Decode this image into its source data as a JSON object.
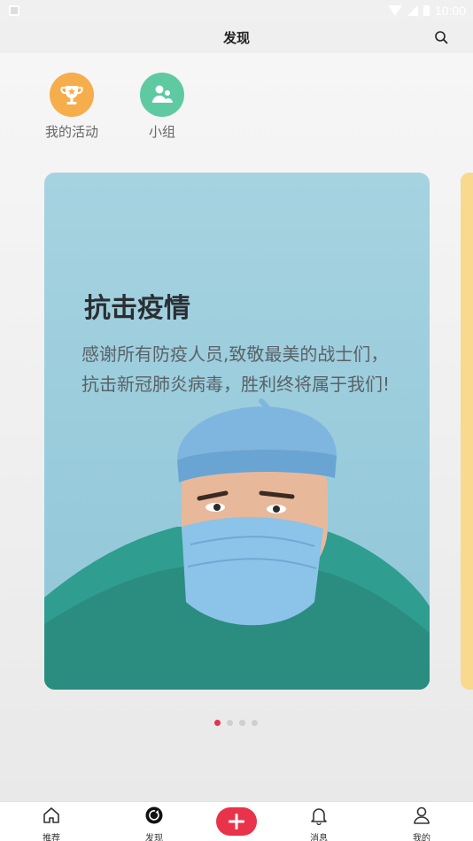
{
  "status_bar": {
    "time": "10:00"
  },
  "header": {
    "title": "发现",
    "search_icon": "search-icon"
  },
  "shortcuts": [
    {
      "label": "我的活动",
      "icon": "trophy-icon",
      "color": "#f6ad4c"
    },
    {
      "label": "小组",
      "icon": "group-icon",
      "color": "#5fcaa2"
    }
  ],
  "carousel": {
    "card": {
      "title": "抗击疫情",
      "description": "感谢所有防疫人员,致敬最美的战士们，抗击新冠肺炎病毒，胜利终将属于我们!"
    },
    "page_count": 4,
    "active_page": 1
  },
  "bottom_nav": {
    "items": [
      {
        "label": "推荐",
        "icon": "home-icon"
      },
      {
        "label": "发现",
        "icon": "discover-icon"
      },
      {
        "label": "消息",
        "icon": "bell-icon"
      },
      {
        "label": "我的",
        "icon": "user-icon"
      }
    ],
    "add_icon": "plus-icon",
    "accent": "#e8334a"
  }
}
